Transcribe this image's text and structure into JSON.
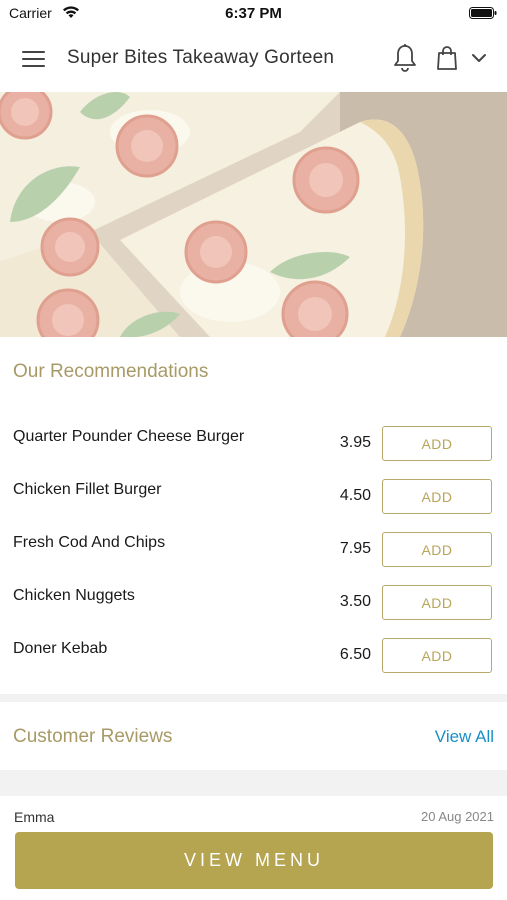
{
  "status_bar": {
    "carrier": "Carrier",
    "time": "6:37 PM"
  },
  "header": {
    "title": "Super Bites Takeaway Gorteen"
  },
  "recommendations": {
    "title": "Our Recommendations",
    "items": [
      {
        "name": "Quarter Pounder Cheese Burger",
        "price": "3.95",
        "action": "ADD"
      },
      {
        "name": "Chicken Fillet Burger",
        "price": "4.50",
        "action": "ADD"
      },
      {
        "name": "Fresh Cod And Chips",
        "price": "7.95",
        "action": "ADD"
      },
      {
        "name": "Chicken Nuggets",
        "price": "3.50",
        "action": "ADD"
      },
      {
        "name": "Doner Kebab",
        "price": "6.50",
        "action": "ADD"
      }
    ]
  },
  "reviews": {
    "title": "Customer Reviews",
    "view_all": "View All",
    "first": {
      "name": "Emma",
      "date": "20 Aug 2021"
    }
  },
  "footer": {
    "view_menu": "VIEW MENU"
  },
  "colors": {
    "accent": "#b5a450",
    "link": "#1a8fc8",
    "section_title": "#a89a66"
  }
}
